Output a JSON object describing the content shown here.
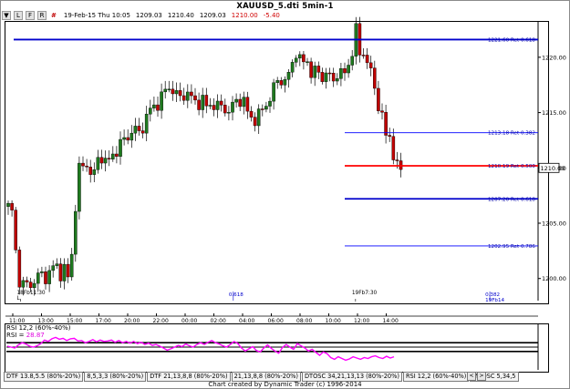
{
  "title": "XAUUSD_5.dti 5min-1",
  "toolbar": {
    "icons": [
      "down-arrow-icon",
      "L",
      "F",
      "R"
    ],
    "symbol_glyph": "#",
    "ohlc": {
      "date": "19-Feb-15 Thu 10:05",
      "open": "1209.03",
      "high": "1210.40",
      "low": "1209.03",
      "close": "1210.00",
      "change": "-5.40"
    }
  },
  "chart_data": [
    {
      "type": "candlestick",
      "title": "XAUUSD_5.dti 5min-1",
      "x_tick_labels": [
        "11:00",
        "13:00",
        "15:00",
        "17:00",
        "20:00",
        "22:00",
        "00:00",
        "02:00",
        "04:00",
        "06:00",
        "08:00",
        "10:00",
        "12:00",
        "14:00"
      ],
      "ylim": [
        1198,
        1223.2
      ],
      "y_tick_labels": [
        "1200.00",
        "1205.00",
        "1210.00",
        "1215.00",
        "1220.00"
      ],
      "last_price_label": "1210.00",
      "price_path": [
        [
          0,
          1206.5
        ],
        [
          0.5,
          1206.8
        ],
        [
          1,
          1205
        ],
        [
          1.5,
          1202
        ],
        [
          2,
          1200.2
        ],
        [
          2.5,
          1199
        ],
        [
          3,
          1199.6
        ],
        [
          4,
          1199.3
        ],
        [
          5,
          1199.8
        ],
        [
          6,
          1200.4
        ],
        [
          7,
          1200.1
        ],
        [
          8,
          1200.6
        ],
        [
          9,
          1201.3
        ],
        [
          10,
          1200.5
        ],
        [
          11,
          1201.0
        ],
        [
          11.5,
          1199.8
        ],
        [
          12,
          1201.6
        ],
        [
          12.5,
          1204
        ],
        [
          13,
          1207.5
        ],
        [
          13.5,
          1209.8
        ],
        [
          14,
          1211.5
        ],
        [
          14.5,
          1208.7
        ],
        [
          15,
          1210.6
        ],
        [
          15.5,
          1210.0
        ],
        [
          16,
          1208.5
        ],
        [
          16.5,
          1209.8
        ],
        [
          17,
          1210.3
        ],
        [
          17.5,
          1211.6
        ],
        [
          18,
          1211.0
        ],
        [
          18.5,
          1210.4
        ],
        [
          19,
          1211.0
        ],
        [
          19.5,
          1210.4
        ],
        [
          20,
          1211.2
        ],
        [
          21,
          1211.8
        ],
        [
          22,
          1212.5
        ],
        [
          23,
          1212.9
        ],
        [
          24,
          1213.6
        ],
        [
          25,
          1213.1
        ],
        [
          26,
          1214.1
        ],
        [
          27,
          1215.2
        ],
        [
          28,
          1215.6
        ],
        [
          29,
          1216.1
        ],
        [
          30,
          1217.0
        ],
        [
          31,
          1217.4
        ],
        [
          32,
          1216.6
        ],
        [
          33,
          1216.3
        ],
        [
          34,
          1216.9
        ],
        [
          35,
          1216.3
        ],
        [
          36,
          1215.8
        ],
        [
          37,
          1216.2
        ],
        [
          38,
          1215.4
        ],
        [
          39,
          1215.9
        ],
        [
          40,
          1215.5
        ],
        [
          41,
          1215.6
        ],
        [
          42,
          1215.0
        ],
        [
          43,
          1215.7
        ],
        [
          44,
          1216.3
        ],
        [
          45,
          1216.0
        ],
        [
          46,
          1214.6
        ],
        [
          47,
          1214.4
        ],
        [
          48,
          1214.8
        ],
        [
          49,
          1215.6
        ],
        [
          50,
          1216.3
        ],
        [
          51,
          1217.6
        ],
        [
          52,
          1218.1
        ],
        [
          53,
          1217.7
        ],
        [
          54,
          1219.0
        ],
        [
          55,
          1220.6
        ],
        [
          56,
          1219.3
        ],
        [
          57,
          1219.9
        ],
        [
          58,
          1218.4
        ],
        [
          59,
          1218.8
        ],
        [
          60,
          1218.2
        ],
        [
          61,
          1218.7
        ],
        [
          62,
          1217.6
        ],
        [
          63,
          1218.9
        ],
        [
          64,
          1218.2
        ],
        [
          65,
          1219.3
        ],
        [
          66,
          1221.2
        ],
        [
          66.5,
          1222.6
        ],
        [
          67,
          1220.5
        ],
        [
          67.5,
          1219.6
        ],
        [
          68,
          1220.8
        ],
        [
          68.5,
          1219.8
        ],
        [
          69,
          1219.0
        ],
        [
          69.5,
          1218.2
        ],
        [
          70,
          1217.2
        ],
        [
          70.5,
          1216.0
        ],
        [
          71,
          1215.3
        ],
        [
          71.5,
          1214.6
        ],
        [
          72,
          1213.0
        ],
        [
          72.5,
          1212.2
        ],
        [
          73,
          1213.1
        ],
        [
          73.5,
          1211.5
        ],
        [
          74,
          1210.4
        ],
        [
          74.5,
          1209.7
        ],
        [
          75,
          1209.9
        ]
      ],
      "levels": [
        {
          "label": "1221.60 Ret 0.618",
          "value": 1221.6,
          "color": "#0000cc",
          "weight": "thick"
        },
        {
          "label": "1213.18 Ret 0.382",
          "value": 1213.18,
          "color": "#0000ff",
          "weight": "thin"
        },
        {
          "label": "1210.19 Ret 0.500",
          "value": 1210.19,
          "color": "#ff0000",
          "weight": "thick"
        },
        {
          "label": "1207.20 Ret 0.618",
          "value": 1207.2,
          "color": "#0000cc",
          "weight": "thick"
        },
        {
          "label": "1202.95 Ret 0.786",
          "value": 1202.95,
          "color": "#0000ff",
          "weight": "thin"
        }
      ],
      "swing_labels": [
        {
          "text": "18Fb11:30",
          "sub": "L",
          "x": 2
        },
        {
          "text": "19Fb7:30",
          "sub": "",
          "x": 66
        }
      ],
      "projection_labels": [
        {
          "text": "0.618",
          "x": 43
        },
        {
          "text": "0.382",
          "sub": "19Fb14",
          "x": 92
        }
      ]
    },
    {
      "type": "line",
      "title": "RSI 12,2 (60%-40%)",
      "series": [
        {
          "name": "RSI",
          "last_value": "28.87"
        }
      ],
      "ylim": [
        0,
        100
      ],
      "levels": [
        60,
        50,
        40
      ],
      "values": [
        52,
        50,
        48,
        55,
        60,
        57,
        52,
        50,
        53,
        58,
        66,
        63,
        69,
        72,
        68,
        70,
        65,
        69,
        70,
        64,
        65,
        60,
        63,
        67,
        62,
        66,
        63,
        64,
        66,
        61,
        65,
        60,
        63,
        59,
        63,
        58,
        61,
        56,
        59,
        54,
        56,
        52,
        48,
        43,
        46,
        50,
        54,
        51,
        57,
        53,
        50,
        56,
        60,
        56,
        61,
        65,
        60,
        57,
        53,
        50,
        56,
        63,
        58,
        48,
        41,
        46,
        51,
        42,
        39,
        48,
        55,
        47,
        41,
        36,
        49,
        56,
        50,
        45,
        58,
        53,
        48,
        41,
        45,
        38,
        31,
        39,
        35,
        26,
        22,
        28,
        24,
        20,
        23,
        28,
        25,
        22,
        26,
        24,
        28,
        30,
        26,
        24,
        29,
        25,
        28
      ]
    }
  ],
  "rsi_legend": {
    "title": "RSI 12,2 (60%-40%)",
    "name": "RSI",
    "value": "28.87"
  },
  "tabs": [
    "DTF 13.8,5.5 (80%-20%)",
    "8,5,3,3 (80%-20%)",
    "DTF 21,13,8,8 (80%-20%)",
    "21,13,8,8 (80%-20%)",
    "DTOSC 34,21,13,13 (80%-20%)",
    "RSI 12,2 (60%-40%)",
    "MAOSC 5,34,5"
  ],
  "nav": [
    "<",
    ">"
  ],
  "credit": "Chart created by Dynamic Trader  (c) 1996-2014",
  "colors": {
    "up": "#1e7a1e",
    "down": "#c00000",
    "rsi": "#ff00ff"
  }
}
